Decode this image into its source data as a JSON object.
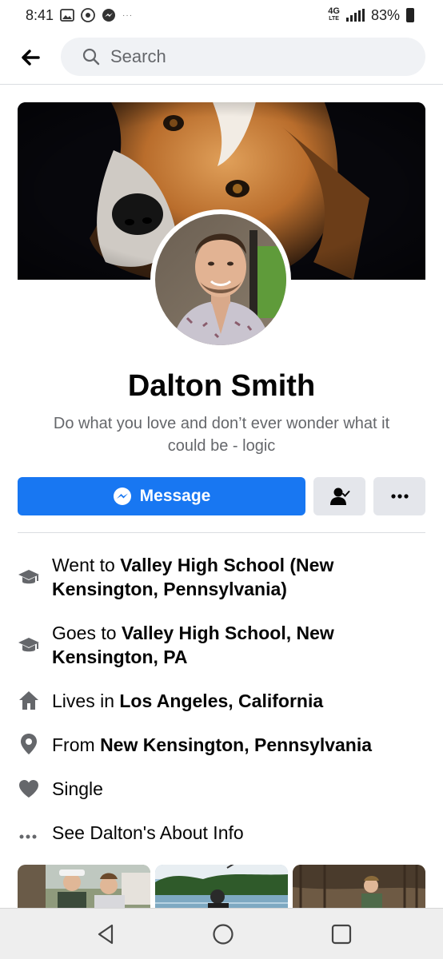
{
  "status_bar": {
    "time": "8:41",
    "network": "4G",
    "network_sub": "LTE",
    "battery": "83%",
    "icons": [
      "gallery-icon",
      "chrome-icon",
      "messenger-icon",
      "more-dots-icon",
      "signal-icon",
      "battery-icon"
    ]
  },
  "header": {
    "search_placeholder": "Search"
  },
  "profile": {
    "name": "Dalton Smith",
    "bio": "Do what you love and don’t ever wonder what it could be - logic"
  },
  "actions": {
    "message_label": "Message",
    "friend_icon": "friends-check-icon",
    "more_icon": "more-horizontal-icon"
  },
  "info": {
    "went_prefix": "Went to ",
    "went_school": "Valley High School (New Kensington, Pennsylvania)",
    "goes_prefix": "Goes to ",
    "goes_school": "Valley High School, New Kensington, PA",
    "lives_prefix": "Lives in ",
    "lives_place": "Los Angeles, California",
    "from_prefix": "From ",
    "from_place": "New Kensington, Pennsylvania",
    "relationship": "Single",
    "about_link": "See Dalton's About Info"
  },
  "colors": {
    "accent": "#1877f2",
    "secondary_button": "#e4e6eb",
    "icon_grey": "#65676b"
  }
}
